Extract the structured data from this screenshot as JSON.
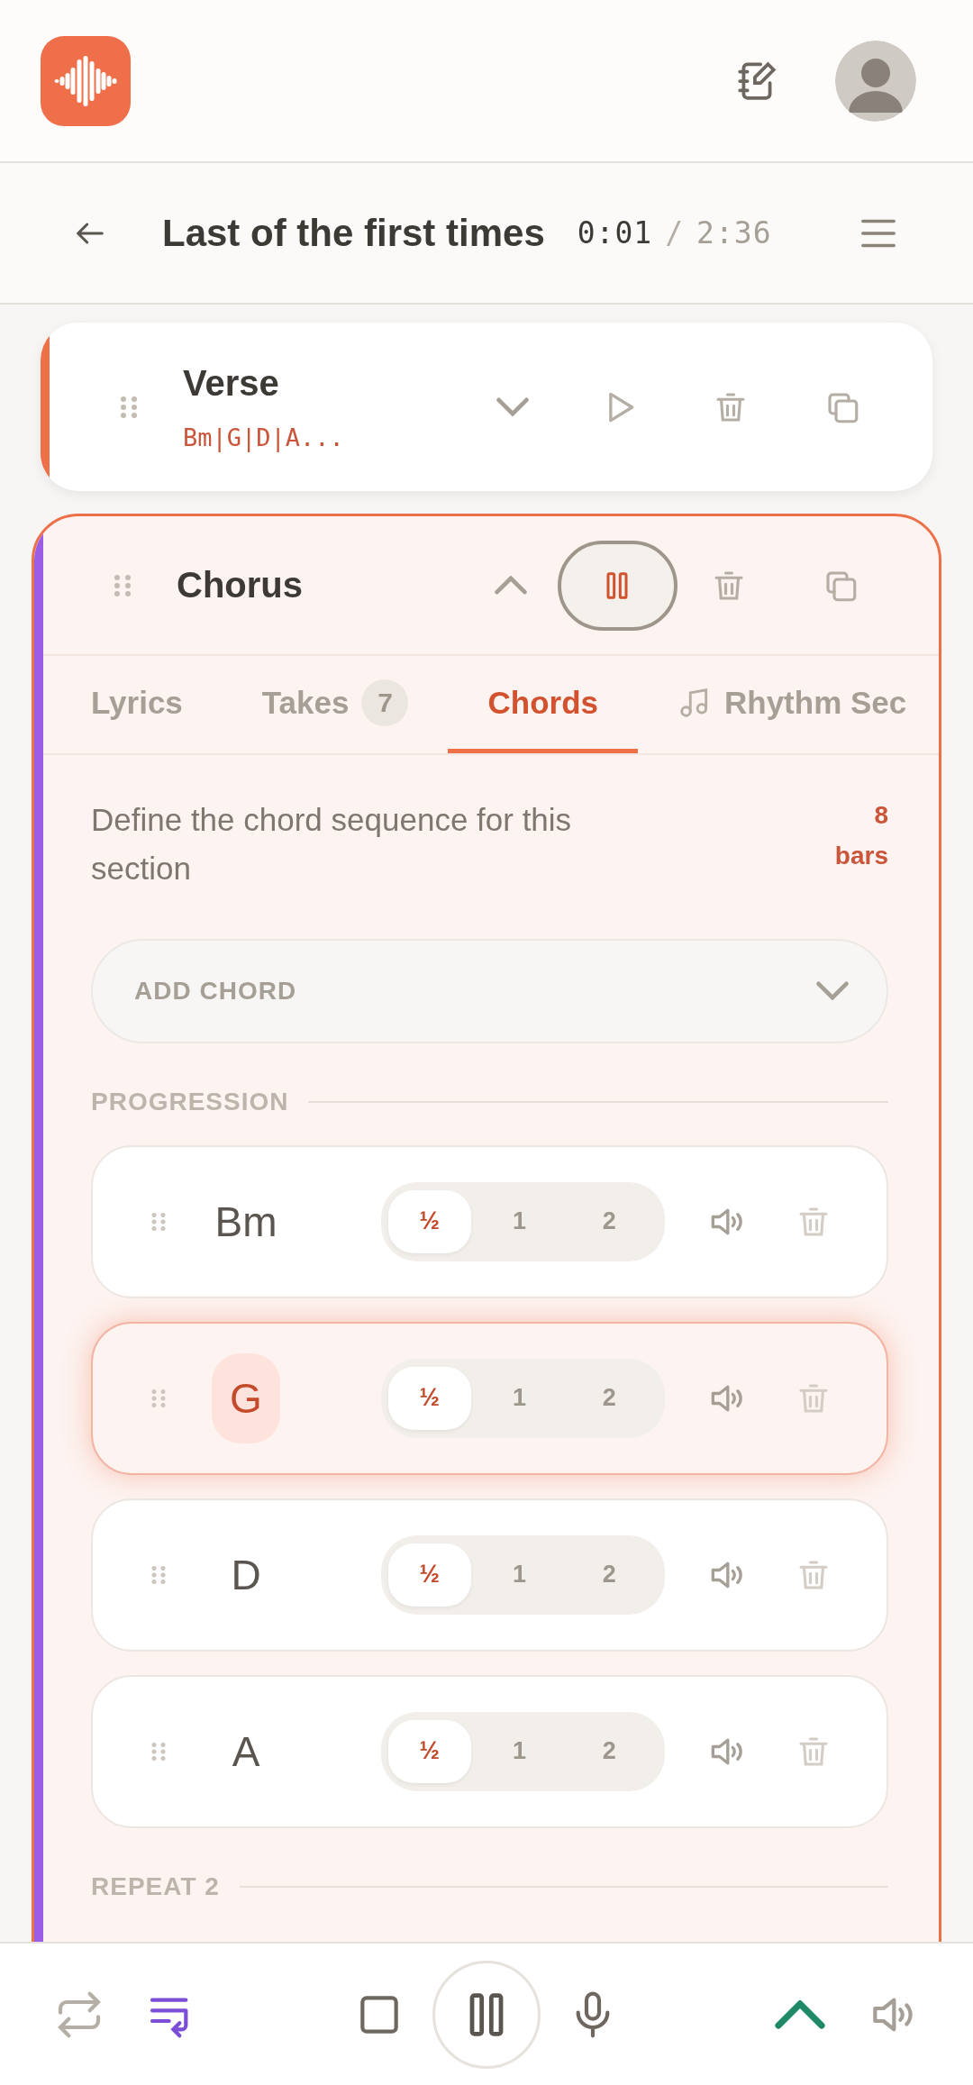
{
  "song": {
    "title": "Last of the first times",
    "elapsed": "0:01",
    "separator": "/",
    "duration": "2:36"
  },
  "sections": [
    {
      "name": "Verse",
      "preview": "Bm|G|D|A...",
      "color": "#ee7048",
      "expanded": false,
      "playing": false
    },
    {
      "name": "Chorus",
      "color": "#9b5de5",
      "expanded": true,
      "playing": true,
      "tabs": [
        {
          "kind": "text",
          "label": "Lyrics",
          "selected": false
        },
        {
          "kind": "count",
          "label": "Takes",
          "count": "7",
          "selected": false
        },
        {
          "kind": "text",
          "label": "Chords",
          "selected": true
        },
        {
          "kind": "music",
          "label": "Rhythm Sec",
          "selected": false
        }
      ],
      "description": "Define the chord sequence for this section",
      "bars": "8 bars",
      "add_chord": "ADD CHORD",
      "groups": [
        {
          "label": "PROGRESSION",
          "chords": [
            {
              "name": "Bm",
              "selected": false,
              "durations": [
                {
                  "label": "½",
                  "selected": true
                },
                {
                  "label": "1",
                  "selected": false
                },
                {
                  "label": "2",
                  "selected": false
                }
              ]
            },
            {
              "name": "G",
              "selected": true,
              "durations": [
                {
                  "label": "½",
                  "selected": true
                },
                {
                  "label": "1",
                  "selected": false
                },
                {
                  "label": "2",
                  "selected": false
                }
              ]
            },
            {
              "name": "D",
              "selected": false,
              "durations": [
                {
                  "label": "½",
                  "selected": true
                },
                {
                  "label": "1",
                  "selected": false
                },
                {
                  "label": "2",
                  "selected": false
                }
              ]
            },
            {
              "name": "A",
              "selected": false,
              "durations": [
                {
                  "label": "½",
                  "selected": true
                },
                {
                  "label": "1",
                  "selected": false
                },
                {
                  "label": "2",
                  "selected": false
                }
              ]
            }
          ]
        },
        {
          "label": "REPEAT 2"
        }
      ]
    }
  ],
  "transport": {
    "repeat": false,
    "follow": true,
    "playing": true
  }
}
